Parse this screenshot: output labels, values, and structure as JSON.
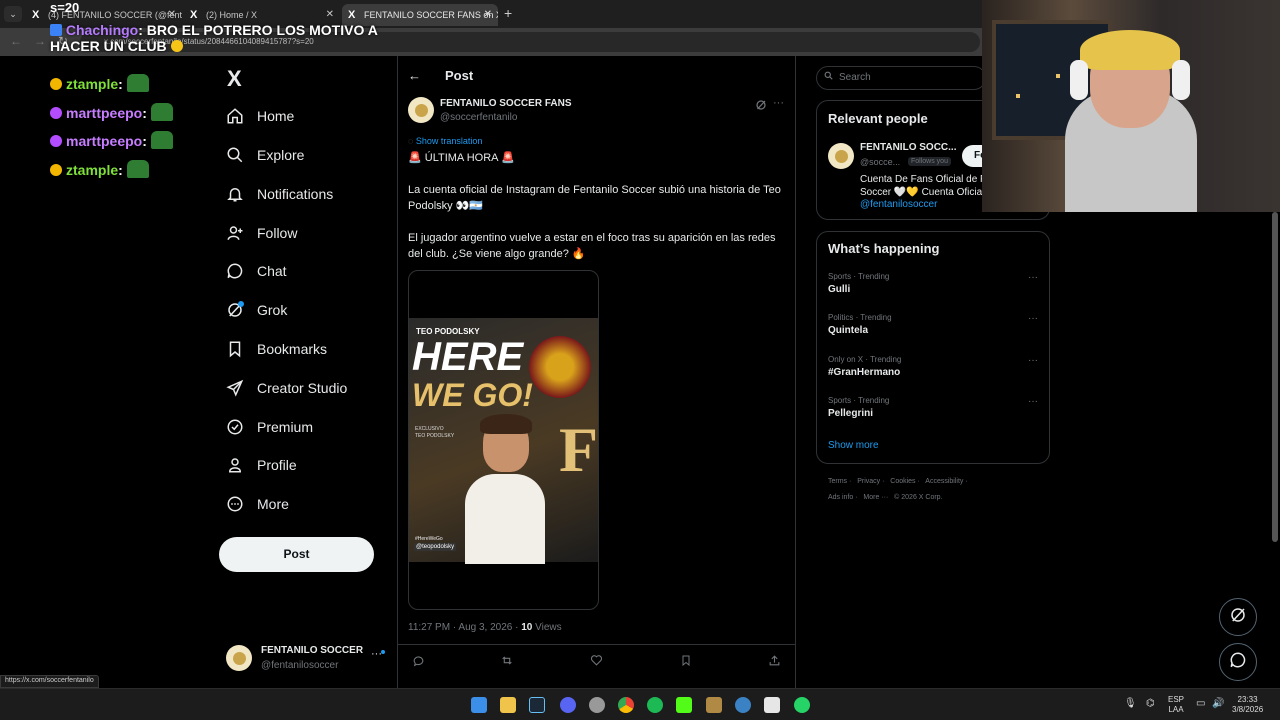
{
  "browser": {
    "tabs": [
      {
        "label": "(4) FENTANILO SOCCER (@fent",
        "favicon": "X",
        "active": false
      },
      {
        "label": "(2) Home / X",
        "favicon": "X",
        "active": false
      },
      {
        "label": "FENTANILO SOCCER FANS on X",
        "favicon": "X",
        "active": true
      }
    ],
    "url": "x.com/soccerfentanilo/status/2084466104089415787?s=20",
    "status_url": "https://x.com/soccerfentanilo"
  },
  "overlay": {
    "top_fragment": "s=20",
    "big_chat": {
      "user": "Chachingo",
      "message": "BRO EL POTRERO LOS MOTIVO A HACER UN CLUB"
    },
    "chat": [
      {
        "user": "ztample",
        "color": "#7fe03a",
        "badge_color": "#f2b600"
      },
      {
        "user": "marttpeepo",
        "color": "#c77dff",
        "badge_color": "#b44cff"
      },
      {
        "user": "marttpeepo",
        "color": "#c77dff",
        "badge_color": "#b44cff"
      },
      {
        "user": "ztample",
        "color": "#7fe03a",
        "badge_color": "#f2b600"
      }
    ]
  },
  "nav": {
    "logo": "X",
    "items": [
      {
        "label": "Home",
        "icon": "home-icon"
      },
      {
        "label": "Explore",
        "icon": "search-icon"
      },
      {
        "label": "Notifications",
        "icon": "bell-icon"
      },
      {
        "label": "Follow",
        "icon": "person-plus-icon"
      },
      {
        "label": "Chat",
        "icon": "chat-icon"
      },
      {
        "label": "Grok",
        "icon": "grok-icon"
      },
      {
        "label": "Bookmarks",
        "icon": "bookmark-icon"
      },
      {
        "label": "Creator Studio",
        "icon": "rocket-icon"
      },
      {
        "label": "Premium",
        "icon": "verified-icon"
      },
      {
        "label": "Profile",
        "icon": "person-icon"
      },
      {
        "label": "More",
        "icon": "more-circle-icon"
      }
    ],
    "post_button": "Post",
    "account": {
      "name": "FENTANILO SOCCER",
      "handle": "@fentanilosoccer"
    }
  },
  "post": {
    "header_title": "Post",
    "author": {
      "name": "FENTANILO SOCCER FANS",
      "handle": "@soccerfentanilo"
    },
    "show_translation": "Show translation",
    "headline": "🚨 ÚLTIMA HORA 🚨",
    "paragraph1": "La cuenta oficial de Instagram de Fentanilo Soccer subió una historia de Teo Podolsky 👀🇦🇷",
    "paragraph2": "El jugador argentino vuelve a estar en el foco tras su aparición en las redes del club. ¿Se viene algo grande? 🔥",
    "image": {
      "name_tag": "TEO PODOLSKY",
      "headline_line1": "HERE",
      "headline_line2": "WE GO!",
      "exclusive": "EXCLUSIVO",
      "exclusive_name": "TEO PODOLSKY",
      "hashtag": "#HereWeGo",
      "instagram": "@teopodolsky"
    },
    "timestamp": "11:27 PM · Aug 3, 2026 · ",
    "views_count": "10",
    "views_label": " Views"
  },
  "right": {
    "search_placeholder": "Search",
    "relevant": {
      "title": "Relevant people",
      "name": "FENTANILO SOCC...",
      "handle": "@socce...",
      "follows_you": "Follows you",
      "follow_button": "Fo",
      "bio_line1": "Cuenta De Fans Oficial de F",
      "bio_line2": "Soccer 🤍💛 Cuenta Oficia",
      "bio_mention": "@fentanilosoccer"
    },
    "happening": {
      "title": "What’s happening",
      "trends": [
        {
          "category": "Sports · Trending",
          "name": "Gulli"
        },
        {
          "category": "Politics · Trending",
          "name": "Quintela"
        },
        {
          "category": "Only on X · Trending",
          "name": "#GranHermano"
        },
        {
          "category": "Sports · Trending",
          "name": "Pellegrini"
        }
      ],
      "show_more": "Show more"
    },
    "footer_line1": [
      "Terms",
      "Privacy",
      "Cookies",
      "Accessibility"
    ],
    "footer_line2": [
      "Ads info",
      "More ···",
      "© 2026 X Corp."
    ]
  },
  "taskbar": {
    "lang1": "ESP",
    "lang2": "LAA",
    "time": "23:33",
    "date": "3/8/2026"
  }
}
